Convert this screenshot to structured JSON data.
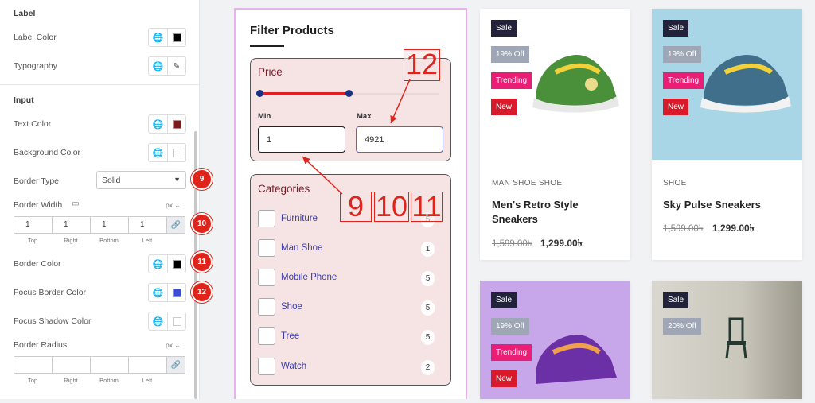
{
  "panel": {
    "label_section": "Label",
    "label_color": "Label Color",
    "typography": "Typography",
    "input_section": "Input",
    "text_color": "Text Color",
    "background_color": "Background Color",
    "border_type": "Border Type",
    "border_type_value": "Solid",
    "border_width": "Border Width",
    "unit": "px",
    "border_width_values": [
      "1",
      "1",
      "1",
      "1"
    ],
    "dim_labels": [
      "Top",
      "Right",
      "Bottom",
      "Left"
    ],
    "border_color": "Border Color",
    "focus_border_color": "Focus Border Color",
    "focus_shadow_color": "Focus Shadow Color",
    "border_radius": "Border Radius",
    "swatches": {
      "label": "#000000",
      "text": "#7a1c1c",
      "background": "#ffffff",
      "border": "#000000",
      "focus_border": "#3b4dd0",
      "focus_shadow": "#ffffff"
    },
    "badges": [
      "9",
      "10",
      "11",
      "12"
    ]
  },
  "filter": {
    "title": "Filter Products",
    "price_title": "Price",
    "min_label": "Min",
    "max_label": "Max",
    "min_value": "1",
    "max_value": "4921",
    "categories_title": "Categories",
    "categories": [
      {
        "name": "Furniture",
        "count": "5"
      },
      {
        "name": "Man Shoe",
        "count": "1"
      },
      {
        "name": "Mobile Phone",
        "count": "5"
      },
      {
        "name": "Shoe",
        "count": "5"
      },
      {
        "name": "Tree",
        "count": "5"
      },
      {
        "name": "Watch",
        "count": "2"
      }
    ],
    "annotations": [
      "12",
      "9",
      "10",
      "11"
    ]
  },
  "products": [
    {
      "sale": "Sale",
      "off": "19% Off",
      "trending": "Trending",
      "new": "New",
      "meta": "MAN SHOE   SHOE",
      "name_line1": "Men's Retro Style",
      "name_line2": "Sneakers",
      "old_price": "1,599.00৳",
      "price": "1,299.00৳"
    },
    {
      "sale": "Sale",
      "off": "19% Off",
      "trending": "Trending",
      "new": "New",
      "meta": "SHOE",
      "name_line1": "Sky Pulse Sneakers",
      "old_price": "1,599.00৳",
      "price": "1,299.00৳"
    },
    {
      "sale": "Sale",
      "off": "19% Off",
      "trending": "Trending",
      "new": "New"
    },
    {
      "sale": "Sale",
      "off": "20% Off"
    }
  ]
}
